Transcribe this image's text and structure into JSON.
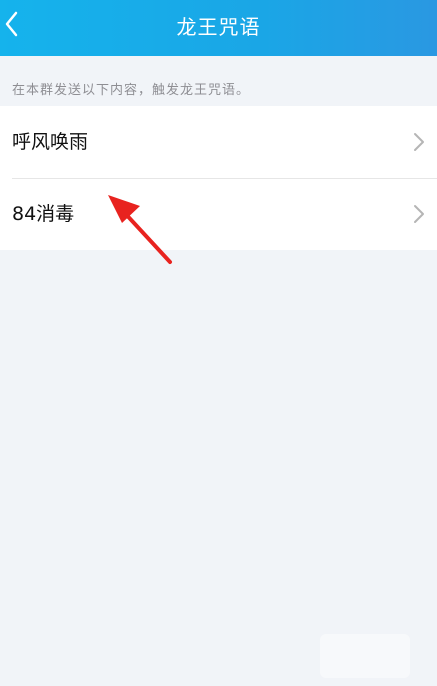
{
  "header": {
    "title": "龙王咒语"
  },
  "hint": {
    "text": "在本群发送以下内容，触发龙王咒语。"
  },
  "list": {
    "items": [
      {
        "label": "呼风唤雨"
      },
      {
        "label": "84消毒"
      }
    ]
  },
  "colors": {
    "header_start": "#15b3ec",
    "header_end": "#2a98e2",
    "background": "#f1f4f8",
    "annotation": "#e8231f"
  },
  "icons": {
    "back": "chevron-left-icon",
    "row": "chevron-right-icon",
    "annotation": "red-arrow-icon"
  }
}
